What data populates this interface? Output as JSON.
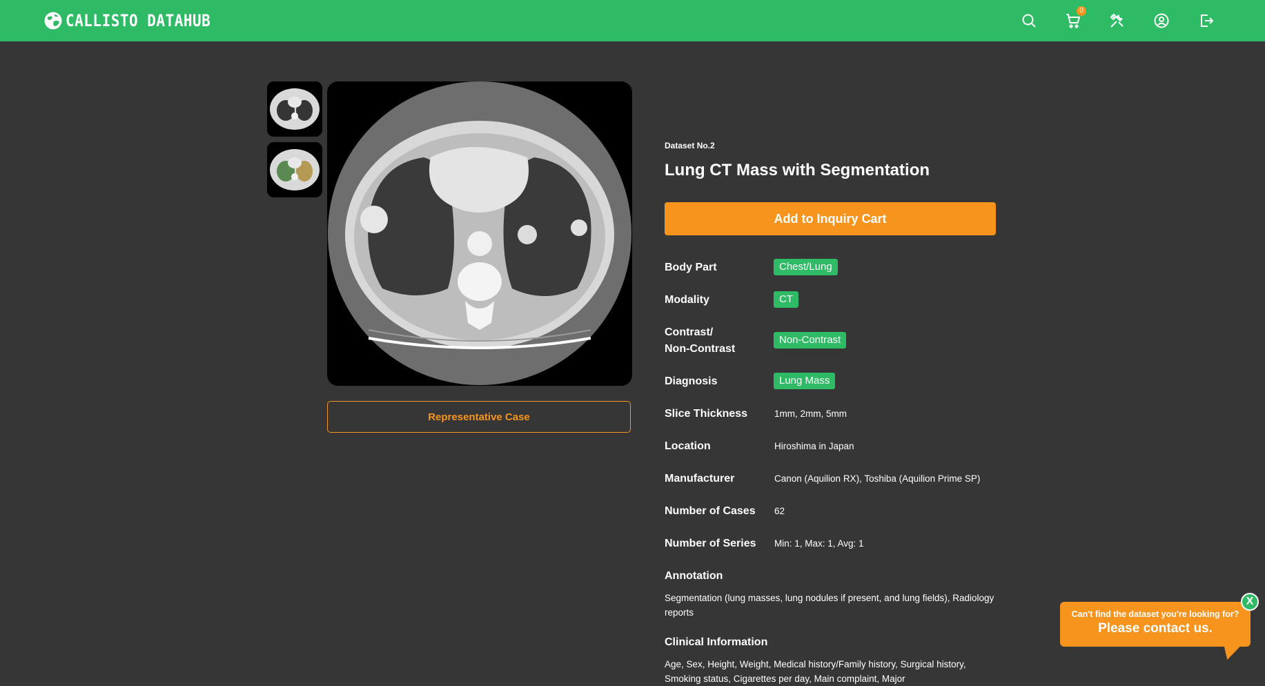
{
  "header": {
    "brand": "CALLISTO DATAHUB",
    "icons": [
      "search-icon",
      "cart-icon",
      "tools-icon",
      "user-icon",
      "logout-icon"
    ],
    "cart_count": "0"
  },
  "gallery": {
    "thumbnails": [
      "ct-scan-thumbnail",
      "segmentation-thumbnail"
    ],
    "representative_label": "Representative Case"
  },
  "dataset": {
    "number": "Dataset No.2",
    "title": "Lung CT Mass with Segmentation",
    "add_to_cart_label": "Add to Inquiry Cart",
    "properties": {
      "body_part": {
        "label": "Body Part",
        "value": "Chest/Lung"
      },
      "modality": {
        "label": "Modality",
        "value": "CT"
      },
      "contrast": {
        "label_line1": "Contrast/",
        "label_line2": "Non-Contrast",
        "value": "Non-Contrast"
      },
      "diagnosis": {
        "label": "Diagnosis",
        "value": "Lung Mass"
      },
      "slice_thickness": {
        "label": "Slice Thickness",
        "value": "1mm, 2mm, 5mm"
      },
      "location": {
        "label": "Location",
        "value": "Hiroshima in Japan"
      },
      "manufacturer": {
        "label": "Manufacturer",
        "value": "Canon (Aquilion RX), Toshiba (Aquilion Prime SP)"
      },
      "cases": {
        "label": "Number of Cases",
        "value": "62"
      },
      "series": {
        "label": "Number of Series",
        "value": "Min: 1, Max: 1, Avg: 1"
      }
    },
    "annotation": {
      "heading": "Annotation",
      "text": "Segmentation (lung masses, lung nodules if present, and lung fields), Radiology reports"
    },
    "clinical": {
      "heading": "Clinical Information",
      "text": "Age, Sex, Height, Weight, Medical history/Family history, Surgical history, Smoking status, Cigarettes per day, Main complaint, Major"
    }
  },
  "contact": {
    "line1": "Can't find the dataset you're looking for?",
    "line2": "Please contact us.",
    "close_label": "X"
  },
  "colors": {
    "header_green": "#2fba66",
    "accent_orange": "#f7941d",
    "background": "#363636"
  }
}
